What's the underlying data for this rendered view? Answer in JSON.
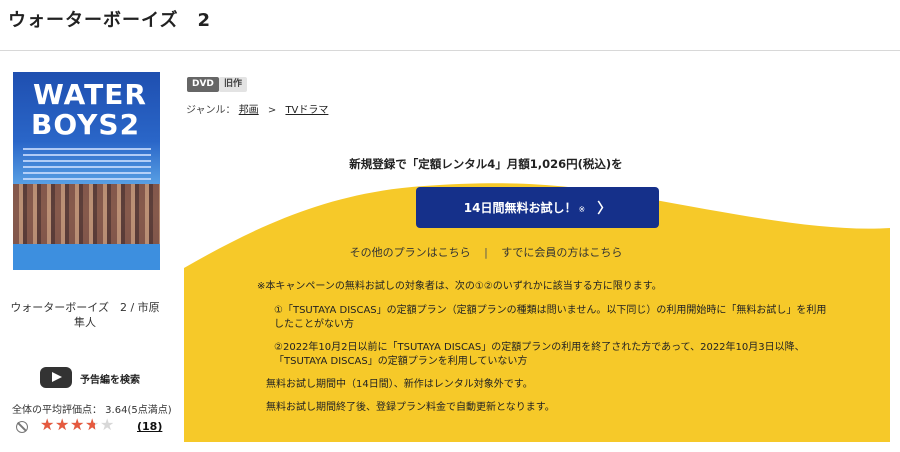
{
  "page": {
    "title": "ウォーターボーイズ　2"
  },
  "product": {
    "poster_text_line1": "WATER",
    "poster_text_line2": "BOYS2",
    "work_name": "ウォーターボーイズ　2 / 市原隼人",
    "trailer_label": "予告編を検索",
    "rating_text": "全体の平均評価点： 3.64(5点満点)",
    "rating_value": 3.64,
    "rating_max": 5,
    "review_count": "(18)"
  },
  "badges": {
    "dvd": "DVD",
    "old": "旧作"
  },
  "genre": {
    "label": "ジャンル：",
    "parent": "邦画",
    "separator": ">",
    "child": "TVドラマ"
  },
  "campaign": {
    "headline": "新規登録で「定額レンタル4」月額1,026円(税込)を",
    "cta_label": "14日間無料お試し！",
    "cta_note": "※",
    "cta_chevron": "〉",
    "link_other_plans": "その他のプランはこちら",
    "link_divider": "|",
    "link_members": "すでに会員の方はこちら",
    "notes": [
      "※本キャンペーンの無料お試しの対象者は、次の①②のいずれかに該当する方に限ります。",
      "①「TSUTAYA DISCAS」の定額プラン（定額プランの種類は問いません。以下同じ）の利用開始時に「無料お試し」を利用したことがない方",
      "②2022年10月2日以前に「TSUTAYA DISCAS」の定額プランの利用を終了された方であって、2022年10月3日以降、「TSUTAYA DISCAS」の定額プランを利用していない方",
      "無料お試し期間中（14日間）、新作はレンタル対象外です。",
      "無料お試し期間終了後、登録プラン料金で自動更新となります。"
    ]
  },
  "colors": {
    "accent_yellow": "#f6c929",
    "cta_blue": "#15308a",
    "star": "#e55a3f"
  },
  "icons": {
    "trailer": "play-icon",
    "not_interested": "ban-icon",
    "cta": "chevron-right-icon"
  }
}
